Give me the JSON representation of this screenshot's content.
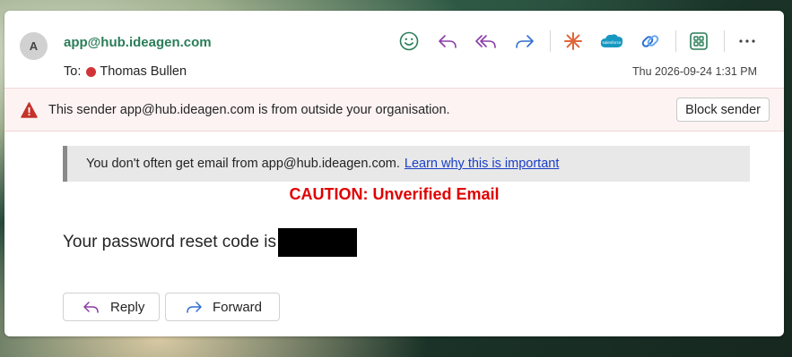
{
  "message": {
    "avatar_initial": "A",
    "sender": "app@hub.ideagen.com",
    "to_label": "To:",
    "recipient": "Thomas Bullen",
    "date": "Thu 2026-09-24 1:31 PM"
  },
  "toolbar": {
    "icons": [
      "emoji-icon",
      "reply-icon",
      "reply-all-icon",
      "forward-icon",
      "copilot-icon",
      "salesforce-icon",
      "link-icon",
      "apps-icon",
      "more-icon"
    ],
    "salesforce_label": "salesforce"
  },
  "external_warning": {
    "text": "This sender app@hub.ideagen.com is from outside your organisation.",
    "block_label": "Block sender"
  },
  "info_notice": {
    "text": "You don't often get email from app@hub.ideagen.com.",
    "link": "Learn why this is important"
  },
  "body": {
    "caution": "CAUTION: Unverified Email",
    "text": "Your password reset code is"
  },
  "actions": {
    "reply_label": "Reply",
    "forward_label": "Forward"
  },
  "colors": {
    "sender": "#2a7d58",
    "caution": "#e00000",
    "accent_purple": "#8a3ba8",
    "accent_blue": "#2f6fd1",
    "warning_red": "#c4342b"
  }
}
